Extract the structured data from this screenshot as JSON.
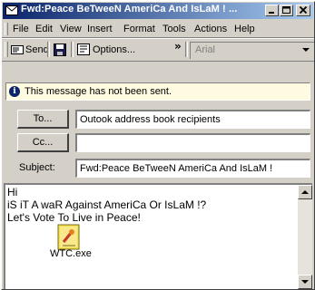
{
  "window": {
    "title": "Fwd:Peace BeTweeN AmeriCa And IsLaM ! ..."
  },
  "menu": [
    "File",
    "Edit",
    "View",
    "Insert",
    "Format",
    "Tools",
    "Actions",
    "Help"
  ],
  "toolbar": {
    "send_label": "Send",
    "options_label": "Options...",
    "font_value": "Arial"
  },
  "infobar": {
    "text": "This message has not been sent."
  },
  "to": {
    "button_label": "To...",
    "value": "Outook address book recipients"
  },
  "cc": {
    "button_label": "Cc...",
    "value": ""
  },
  "subject": {
    "label": "Subject:",
    "value": "Fwd:Peace BeTweeN AmeriCa And IsLaM !"
  },
  "body": {
    "lines": [
      "Hi",
      "iS iT A waR Against AmeriCa Or IsLaM !?",
      "Let's Vote To Live in Peace!"
    ],
    "attachment": "WTC.exe"
  }
}
